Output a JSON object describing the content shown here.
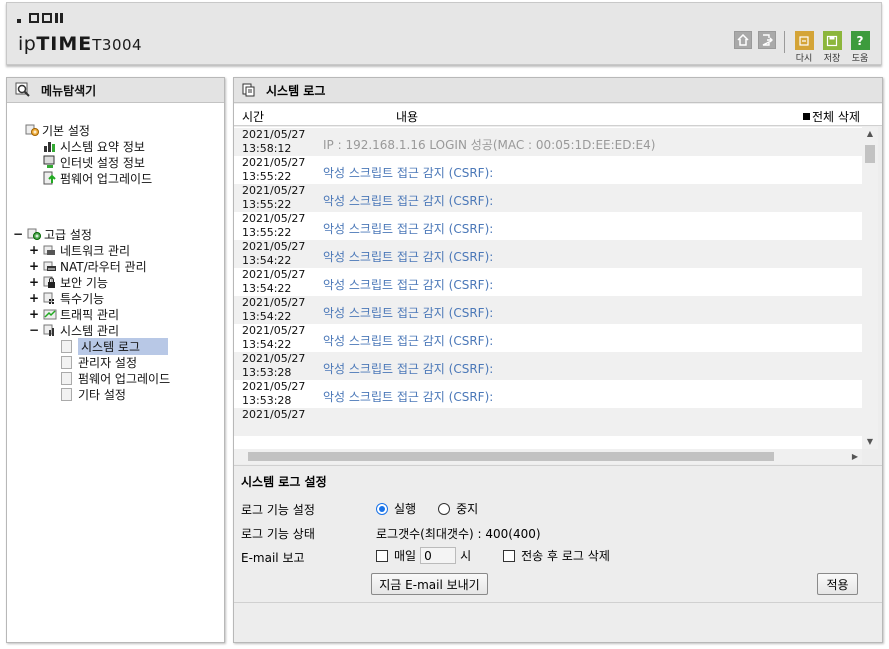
{
  "header": {
    "brand_prefix": "ip",
    "brand_bold": "TIME",
    "model": "T3004",
    "buttons": [
      {
        "label": "다시",
        "color": "#d4a437",
        "icon": "undo-icon"
      },
      {
        "label": "저장",
        "color": "#8cb63c",
        "icon": "save-icon"
      },
      {
        "label": "도움",
        "color": "#3d9b3d",
        "icon": "help-icon"
      }
    ]
  },
  "menu": {
    "title": "메뉴탐색기",
    "basic": {
      "label": "기본 설정",
      "items": [
        "시스템 요약 정보",
        "인터넷 설정 정보",
        "펌웨어 업그레이드"
      ]
    },
    "advanced": {
      "label": "고급 설정",
      "items": [
        "네트워크 관리",
        "NAT/라우터 관리",
        "보안 기능",
        "특수기능",
        "트래픽 관리",
        "시스템 관리"
      ],
      "system_children": [
        "시스템 로그",
        "관리자 설정",
        "펌웨어 업그레이드",
        "기타 설정"
      ]
    }
  },
  "log": {
    "title": "시스템 로그",
    "col_time": "시간",
    "col_content": "내용",
    "delete_all": "전체 삭제",
    "rows": [
      {
        "date": "2021/05/27",
        "time": "13:58:12",
        "msg": "IP : 192.168.1.16 LOGIN 성공(MAC : 00:05:1D:EE:ED:E4)",
        "kind": "login"
      },
      {
        "date": "2021/05/27",
        "time": "13:55:22",
        "msg": "악성 스크립트 접근 감지 (CSRF):",
        "kind": "alert"
      },
      {
        "date": "2021/05/27",
        "time": "13:55:22",
        "msg": "악성 스크립트 접근 감지 (CSRF):",
        "kind": "alert"
      },
      {
        "date": "2021/05/27",
        "time": "13:55:22",
        "msg": "악성 스크립트 접근 감지 (CSRF):",
        "kind": "alert"
      },
      {
        "date": "2021/05/27",
        "time": "13:54:22",
        "msg": "악성 스크립트 접근 감지 (CSRF):",
        "kind": "alert"
      },
      {
        "date": "2021/05/27",
        "time": "13:54:22",
        "msg": "악성 스크립트 접근 감지 (CSRF):",
        "kind": "alert"
      },
      {
        "date": "2021/05/27",
        "time": "13:54:22",
        "msg": "악성 스크립트 접근 감지 (CSRF):",
        "kind": "alert"
      },
      {
        "date": "2021/05/27",
        "time": "13:54:22",
        "msg": "악성 스크립트 접근 감지 (CSRF):",
        "kind": "alert"
      },
      {
        "date": "2021/05/27",
        "time": "13:53:28",
        "msg": "악성 스크립트 접근 감지 (CSRF):",
        "kind": "alert"
      },
      {
        "date": "2021/05/27",
        "time": "13:53:28",
        "msg": "악성 스크립트 접근 감지 (CSRF):",
        "kind": "alert"
      },
      {
        "date": "2021/05/27",
        "time": "",
        "msg": "",
        "kind": "partial"
      }
    ]
  },
  "settings": {
    "title": "시스템 로그 설정",
    "func_label": "로그 기능 설정",
    "run_label": "실행",
    "stop_label": "중지",
    "status_label": "로그 기능 상태",
    "status_value": "로그갯수(최대갯수) : 400(400)",
    "email_label": "E-mail 보고",
    "daily_label": "매일",
    "hour_value": "0",
    "hour_unit": "시",
    "delete_after_label": "전송 후 로그 삭제",
    "send_now_label": "지금 E-mail 보내기",
    "apply_label": "적용"
  }
}
